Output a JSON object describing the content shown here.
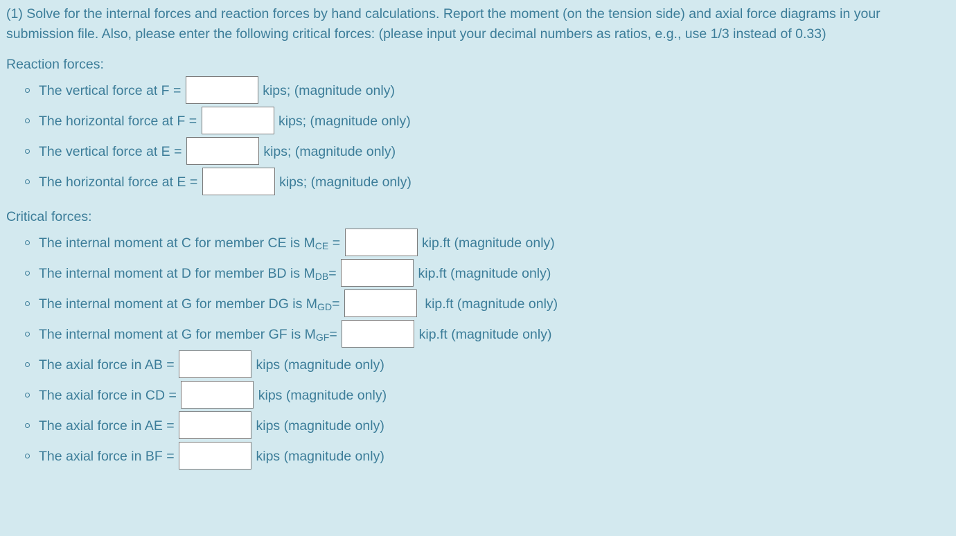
{
  "prompt": {
    "text": "(1) Solve for the internal forces and reaction forces by hand calculations. Report the moment (on the tension side) and axial force diagrams in your submission file. Also, please enter the following critical forces: (please input your decimal numbers as ratios, e.g., use 1/3 instead of 0.33)"
  },
  "sections": {
    "reaction": {
      "label": "Reaction forces:",
      "items": [
        {
          "prefix": "The vertical force at F =",
          "value": "",
          "unit": "kips; (magnitude only)"
        },
        {
          "prefix": "The horizontal force at F =",
          "value": "",
          "unit": "kips; (magnitude only)"
        },
        {
          "prefix": "The vertical force at E =",
          "value": "",
          "unit": "kips; (magnitude only)"
        },
        {
          "prefix": "The horizontal force at E =",
          "value": "",
          "unit": "kips; (magnitude only)"
        }
      ]
    },
    "critical": {
      "label": "Critical forces:",
      "moment_items": [
        {
          "prefix": "The internal moment at C for member CE is M",
          "subscript": "CE",
          "suffix": " =",
          "value": "",
          "unit": "kip.ft (magnitude only)"
        },
        {
          "prefix": "The internal moment at D for member BD is M",
          "subscript": "DB",
          "suffix": "=",
          "value": "",
          "unit": "kip.ft (magnitude only)"
        },
        {
          "prefix": "The internal moment at G for member DG is M",
          "subscript": "GD",
          "suffix": "=",
          "value": "",
          "unit": "kip.ft (magnitude only)"
        },
        {
          "prefix": "The internal moment at G for member GF is M",
          "subscript": "GF",
          "suffix": "=",
          "value": "",
          "unit": "kip.ft (magnitude only)"
        }
      ],
      "axial_items": [
        {
          "prefix": "The axial force in AB =",
          "value": "",
          "unit": "kips (magnitude only)"
        },
        {
          "prefix": "The axial force in CD =",
          "value": "",
          "unit": "kips (magnitude only)"
        },
        {
          "prefix": "The axial force in AE =",
          "value": "",
          "unit": "kips (magnitude only)"
        },
        {
          "prefix": "The axial force in BF =",
          "value": "",
          "unit": "kips (magnitude only)"
        }
      ]
    }
  },
  "colors": {
    "background": "#d3e9ef",
    "text": "#3c7d99",
    "input_border": "#7c7c7c",
    "input_background": "#ffffff"
  }
}
